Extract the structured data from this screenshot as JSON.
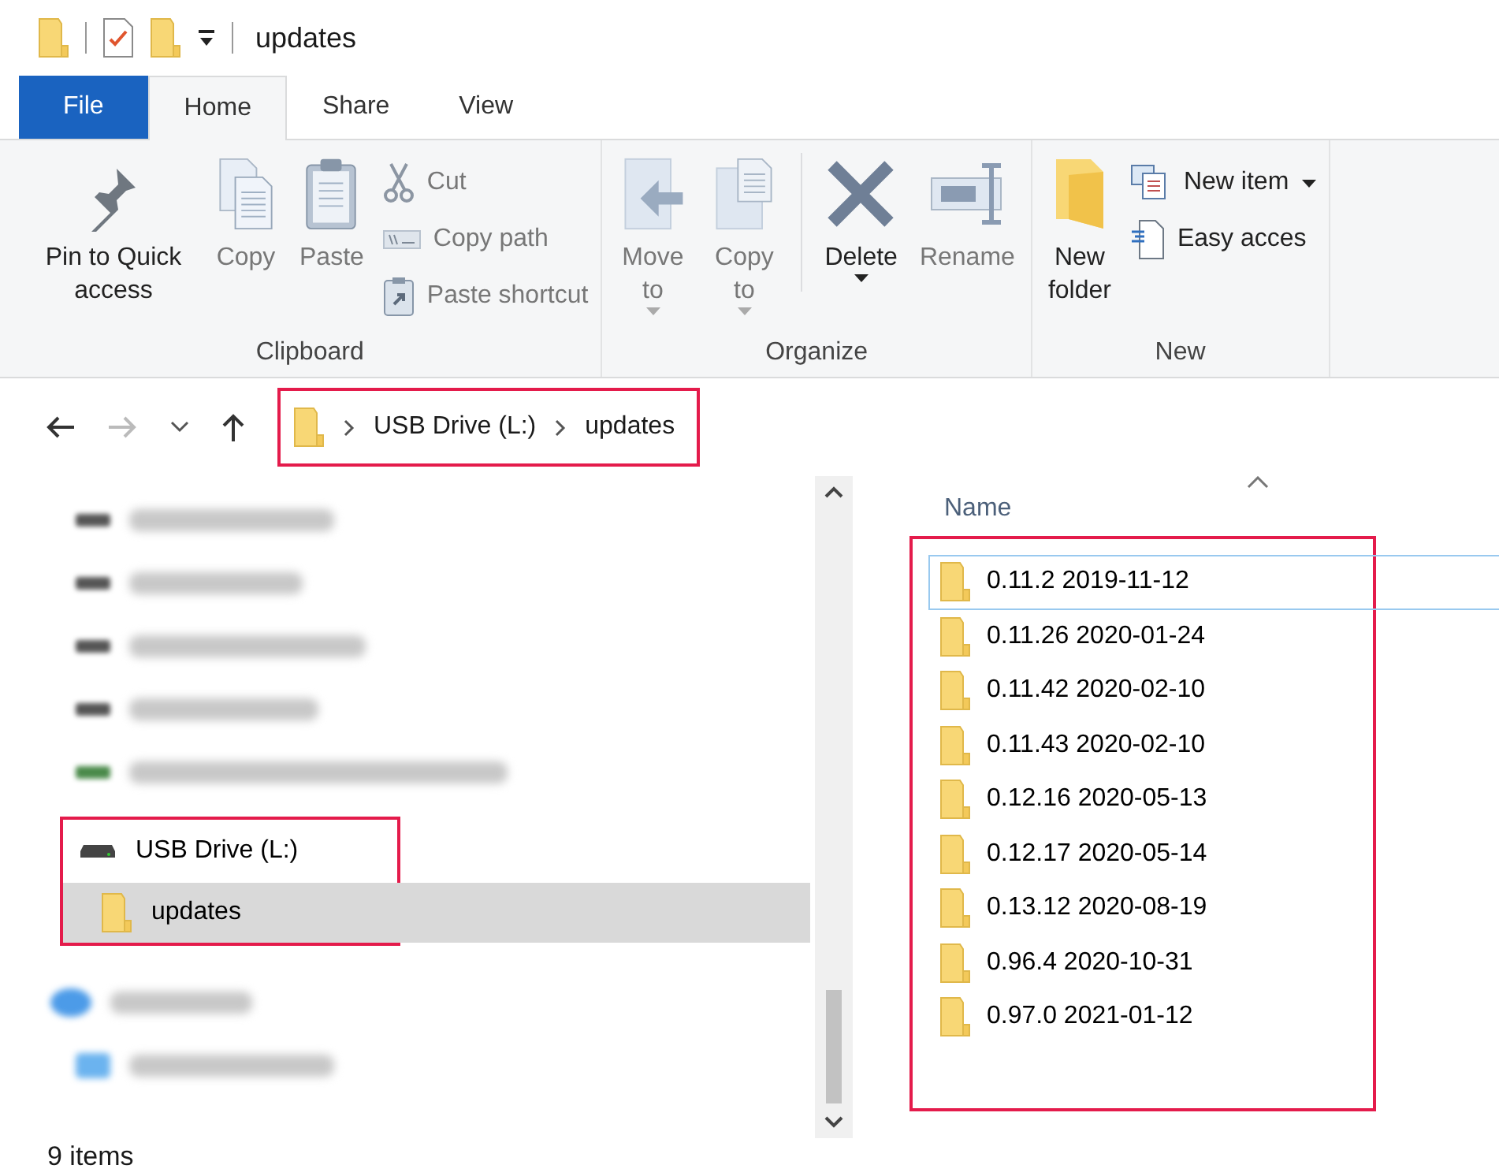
{
  "window": {
    "title": "updates"
  },
  "tabs": [
    {
      "label": "File",
      "kind": "file",
      "selected": false
    },
    {
      "label": "Home",
      "kind": "tab",
      "selected": true
    },
    {
      "label": "Share",
      "kind": "tab",
      "selected": false
    },
    {
      "label": "View",
      "kind": "tab",
      "selected": false
    }
  ],
  "ribbon": {
    "groups": [
      {
        "label": "Clipboard",
        "large_buttons": [
          {
            "label": "Pin to Quick access",
            "kind": "pin",
            "disabled": false,
            "dropdown": false
          },
          {
            "label": "Copy",
            "kind": "copy",
            "disabled": true,
            "dropdown": false
          },
          {
            "label": "Paste",
            "kind": "paste",
            "disabled": true,
            "dropdown": false
          }
        ],
        "small_buttons": [
          {
            "label": "Cut",
            "kind": "cut",
            "disabled": true,
            "dropdown": false
          },
          {
            "label": "Copy path",
            "kind": "copypath",
            "disabled": true,
            "dropdown": false
          },
          {
            "label": "Paste shortcut",
            "kind": "shortcut",
            "disabled": true,
            "dropdown": false
          }
        ]
      },
      {
        "label": "Organize",
        "large_buttons": [
          {
            "label": "Move to",
            "kind": "move",
            "disabled": true,
            "dropdown": true
          },
          {
            "label": "Copy to",
            "kind": "copyto",
            "disabled": true,
            "dropdown": true
          },
          {
            "label": "Delete",
            "kind": "delete",
            "disabled": false,
            "dropdown": true
          },
          {
            "label": "Rename",
            "kind": "rename",
            "disabled": true,
            "dropdown": false
          }
        ]
      },
      {
        "label": "New",
        "large_buttons": [
          {
            "label": "New folder",
            "kind": "folder",
            "disabled": false,
            "dropdown": false
          }
        ],
        "small_buttons": [
          {
            "label": "New item",
            "kind": "newitem",
            "disabled": false,
            "dropdown": true
          },
          {
            "label": "Easy acces",
            "kind": "easy",
            "disabled": false,
            "dropdown": false
          }
        ]
      }
    ]
  },
  "address_bar": {
    "highlight": true,
    "crumbs": [
      "USB Drive (L:)",
      "updates"
    ]
  },
  "nav": [
    {
      "kind": "blurred-drive"
    },
    {
      "kind": "blurred-drive"
    },
    {
      "kind": "blurred-drive"
    },
    {
      "kind": "blurred-drive"
    },
    {
      "kind": "blurred-share"
    },
    {
      "kind": "drive",
      "label": "USB Drive (L:)",
      "selected": false,
      "highlight": true,
      "children": [
        {
          "label": "updates",
          "selected": true
        }
      ]
    },
    {
      "kind": "blurred-network"
    },
    {
      "kind": "blurred-pc"
    }
  ],
  "file_list": {
    "column": "Name",
    "highlight": true,
    "items": [
      {
        "label": "0.11.2 2019-11-12",
        "focused": true
      },
      {
        "label": "0.11.26 2020-01-24",
        "focused": false
      },
      {
        "label": "0.11.42 2020-02-10",
        "focused": false
      },
      {
        "label": "0.11.43 2020-02-10",
        "focused": false
      },
      {
        "label": "0.12.16 2020-05-13",
        "focused": false
      },
      {
        "label": "0.12.17 2020-05-14",
        "focused": false
      },
      {
        "label": "0.13.12 2020-08-19",
        "focused": false
      },
      {
        "label": "0.96.4 2020-10-31",
        "focused": false
      },
      {
        "label": "0.97.0 2021-01-12",
        "focused": false
      }
    ]
  },
  "status_bar": {
    "count": "9 items"
  }
}
